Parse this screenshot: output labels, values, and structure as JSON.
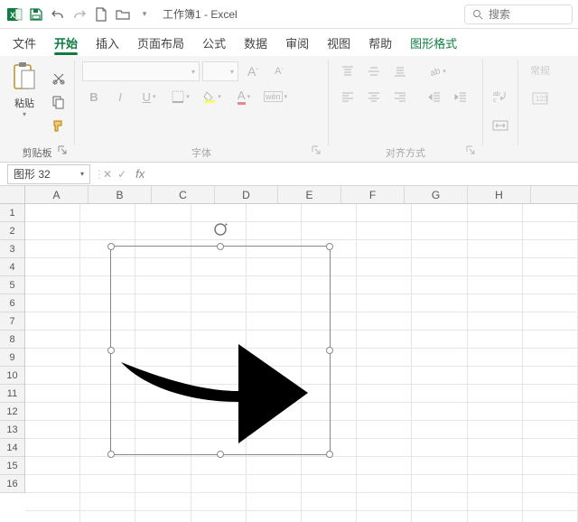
{
  "titlebar": {
    "app_name": "Excel",
    "doc_name": "工作簿1",
    "separator": " - "
  },
  "search": {
    "placeholder": "搜索"
  },
  "tabs": {
    "file": "文件",
    "home": "开始",
    "insert": "插入",
    "layout": "页面布局",
    "formulas": "公式",
    "data": "数据",
    "review": "审阅",
    "view": "视图",
    "help": "帮助",
    "shape_format": "图形格式"
  },
  "ribbon": {
    "clipboard": {
      "label": "剪贴板",
      "paste": "粘贴"
    },
    "font": {
      "label": "字体"
    },
    "alignment": {
      "label": "对齐方式"
    },
    "general": {
      "label": "常规"
    }
  },
  "namebox": {
    "value": "图形 32"
  },
  "columns": [
    "A",
    "B",
    "C",
    "D",
    "E",
    "F",
    "G",
    "H"
  ],
  "rows": [
    "1",
    "2",
    "3",
    "4",
    "5",
    "6",
    "7",
    "8",
    "9",
    "10",
    "11",
    "12",
    "13",
    "14",
    "15",
    "16"
  ]
}
